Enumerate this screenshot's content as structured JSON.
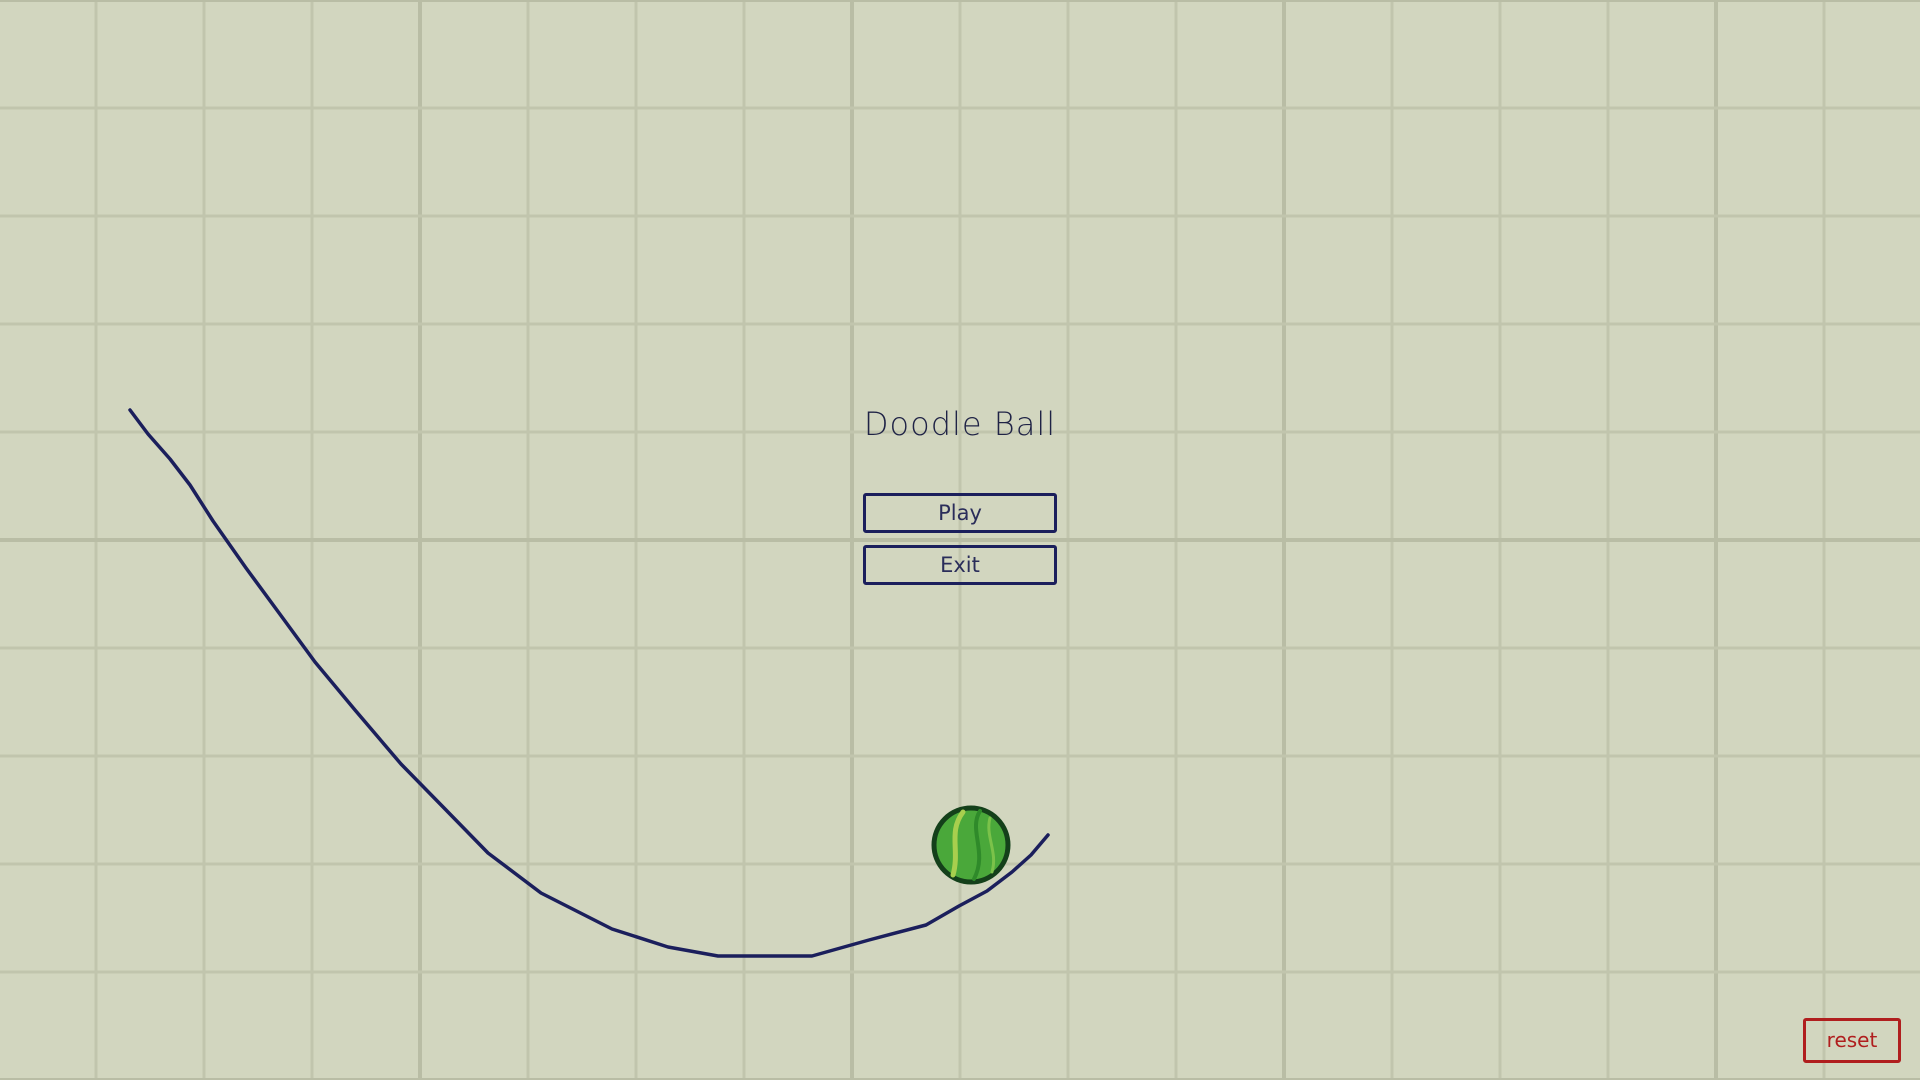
{
  "game": {
    "title": "Doodle Ball"
  },
  "menu": {
    "play_label": "Play",
    "exit_label": "Exit"
  },
  "controls": {
    "reset_label": "reset"
  },
  "colors": {
    "background": "#d2d6bf",
    "grid_line": "#c1c5ad",
    "grid_line_major": "#b9bda5",
    "ink": "#1b1f5c",
    "ball_outline": "#14401a",
    "ball_fill": "#4aa83a",
    "ball_stripe": "#a8cf4e",
    "reset": "#b01e1e"
  },
  "icons": {
    "ball": "green-marble-ball-icon"
  }
}
